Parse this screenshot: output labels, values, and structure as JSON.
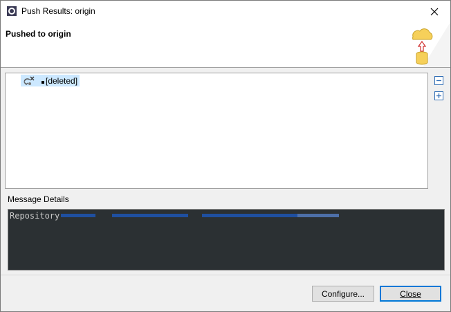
{
  "window": {
    "title": "Push Results: origin"
  },
  "header": {
    "title": "Pushed to origin"
  },
  "tree": {
    "items": [
      {
        "label": "[deleted]"
      }
    ]
  },
  "message": {
    "label": "Message Details",
    "text": "Repository"
  },
  "buttons": {
    "configure": "Configure...",
    "close": "Close"
  },
  "icons": {
    "app": "eclipse-icon",
    "close": "close-icon",
    "header": "push-cloud-icon",
    "tree_item": "deleted-ref-icon",
    "collapse": "collapse-all-icon",
    "expand": "expand-all-icon"
  },
  "colors": {
    "selection": "#cce8ff",
    "console_bg": "#2b3033",
    "default_button_border": "#0078d7"
  }
}
